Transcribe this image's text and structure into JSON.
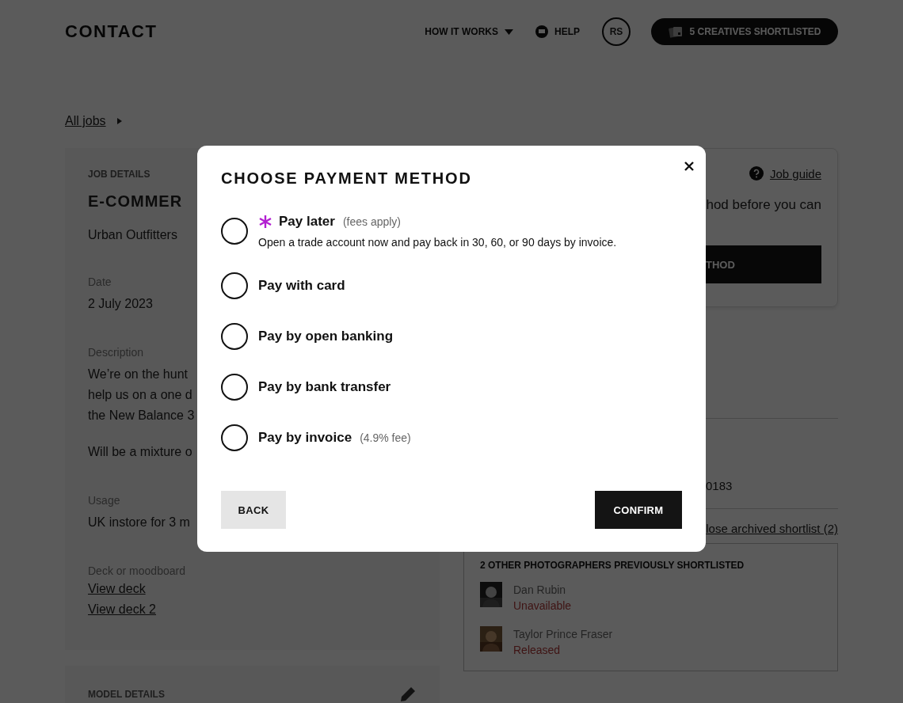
{
  "header": {
    "logo": "CONTACT",
    "nav": [
      {
        "kind": "dropdown",
        "label": "HOW IT WORKS"
      },
      {
        "kind": "help",
        "label": "HELP"
      }
    ],
    "avatar_initials": "RS",
    "shortlist_button": "5 CREATIVES SHORTLISTED"
  },
  "breadcrumb": {
    "link": "All jobs"
  },
  "job_details": {
    "heading": "JOB DETAILS",
    "title": "E-COMMER",
    "client": "Urban Outfitters",
    "fields": [
      {
        "kind": "text",
        "label": "Date",
        "paragraphs": [
          [
            "2 July 2023"
          ]
        ]
      },
      {
        "kind": "text",
        "label": "Description",
        "paragraphs": [
          [
            "We’re on the hunt",
            "help us on a one d",
            "the New Balance 3"
          ],
          [
            "Will be a mixture o"
          ]
        ]
      },
      {
        "kind": "text",
        "label": "Usage",
        "paragraphs": [
          [
            "UK instore for 3 m"
          ]
        ]
      },
      {
        "kind": "links",
        "label": "Deck or moodboard",
        "links": [
          "View deck",
          "View deck 2"
        ]
      }
    ]
  },
  "model_details": {
    "heading": "MODEL DETAILS"
  },
  "payment_card": {
    "guide_link": "Job guide",
    "notice": "hod before you can",
    "button": "THOD"
  },
  "reference": "0183",
  "archived_link": "lose archived shortlist (2)",
  "previous": {
    "heading": "2 OTHER PHOTOGRAPHERS PREVIOUSLY SHORTLISTED",
    "people": [
      {
        "name": "Dan Rubin",
        "status": "Unavailable"
      },
      {
        "name": "Taylor Prince Fraser",
        "status": "Released"
      }
    ]
  },
  "modal": {
    "title": "CHOOSE PAYMENT METHOD",
    "options": [
      {
        "kind": "featured",
        "label": "Pay later",
        "note": "(fees apply)",
        "description": "Open a trade account now and pay back in 30, 60, or 90 days by invoice.",
        "selected": false
      },
      {
        "kind": "plain",
        "label": "Pay with card",
        "selected": false
      },
      {
        "kind": "plain",
        "label": "Pay by open banking",
        "selected": false
      },
      {
        "kind": "plain",
        "label": "Pay by bank transfer",
        "selected": false
      },
      {
        "kind": "plain",
        "label": "Pay by invoice",
        "note": "(4.9% fee)",
        "selected": false
      }
    ],
    "back_button": "BACK",
    "confirm_button": "CONFIRM"
  }
}
